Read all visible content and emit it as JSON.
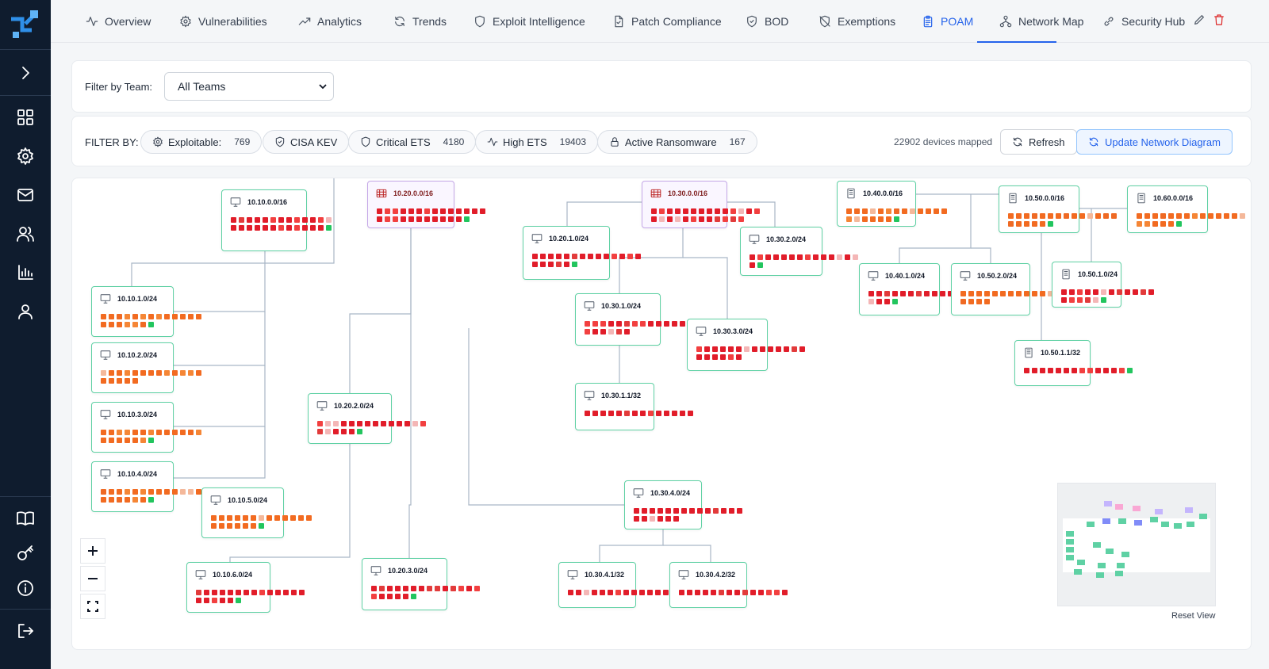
{
  "tabs": [
    {
      "label": "Overview",
      "icon": "activity-icon"
    },
    {
      "label": "Vulnerabilities",
      "icon": "bug-icon"
    },
    {
      "label": "Analytics",
      "icon": "trending-up-icon"
    },
    {
      "label": "Trends",
      "icon": "refresh-icon"
    },
    {
      "label": "Exploit Intelligence",
      "icon": "shield-icon"
    },
    {
      "label": "Patch Compliance",
      "icon": "file-icon"
    },
    {
      "label": "BOD",
      "icon": "shield-check-icon"
    },
    {
      "label": "Exemptions",
      "icon": "shield-off-icon"
    },
    {
      "label": "POAM",
      "icon": "clipboard-icon"
    },
    {
      "label": "Network Map",
      "icon": "network-icon"
    },
    {
      "label": "Security Hub",
      "icon": "link-icon"
    }
  ],
  "active_tab": "POAM",
  "team_filter": {
    "label": "Filter by Team:",
    "value": "All Teams"
  },
  "filters": {
    "label": "FILTER BY:",
    "chips": [
      {
        "label": "Exploitable:",
        "count": "769"
      },
      {
        "label": "CISA KEV",
        "count": ""
      },
      {
        "label": "Critical ETS",
        "count": "4180"
      },
      {
        "label": "High ETS",
        "count": "19403"
      },
      {
        "label": "Active Ransomware",
        "count": "167"
      }
    ],
    "devices_mapped": "22902 devices mapped",
    "refresh_label": "Refresh",
    "update_label": "Update Network Diagram"
  },
  "nodes": [
    {
      "label": "10.10.0.0/16",
      "type": "monitor"
    },
    {
      "label": "10.20.0.0/16",
      "type": "hub"
    },
    {
      "label": "10.30.0.0/16",
      "type": "hub"
    },
    {
      "label": "10.40.0.0/16",
      "type": "server"
    },
    {
      "label": "10.50.0.0/16",
      "type": "server"
    },
    {
      "label": "10.60.0.0/16",
      "type": "server"
    },
    {
      "label": "10.10.1.0/24",
      "type": "monitor"
    },
    {
      "label": "10.10.2.0/24",
      "type": "monitor"
    },
    {
      "label": "10.10.3.0/24",
      "type": "monitor"
    },
    {
      "label": "10.10.4.0/24",
      "type": "monitor"
    },
    {
      "label": "10.10.5.0/24",
      "type": "monitor"
    },
    {
      "label": "10.10.6.0/24",
      "type": "monitor"
    },
    {
      "label": "10.20.1.0/24",
      "type": "monitor"
    },
    {
      "label": "10.20.2.0/24",
      "type": "monitor"
    },
    {
      "label": "10.20.3.0/24",
      "type": "monitor"
    },
    {
      "label": "10.30.1.0/24",
      "type": "monitor"
    },
    {
      "label": "10.30.2.0/24",
      "type": "monitor"
    },
    {
      "label": "10.30.3.0/24",
      "type": "monitor"
    },
    {
      "label": "10.30.1.1/32",
      "type": "monitor"
    },
    {
      "label": "10.30.4.0/24",
      "type": "monitor"
    },
    {
      "label": "10.30.4.1/32",
      "type": "monitor"
    },
    {
      "label": "10.30.4.2/32",
      "type": "monitor"
    },
    {
      "label": "10.40.1.0/24",
      "type": "monitor"
    },
    {
      "label": "10.50.2.0/24",
      "type": "monitor"
    },
    {
      "label": "10.50.1.0/24",
      "type": "server"
    },
    {
      "label": "10.50.1.1/32",
      "type": "server"
    }
  ],
  "reset_view_label": "Reset View",
  "colors": {
    "accent": "#2563eb",
    "node_border": "#5fd1a4",
    "hub_border": "#c4a7e7",
    "critical": "#e11d2a",
    "high": "#f26b21",
    "sidebar": "#0f1c2e"
  }
}
